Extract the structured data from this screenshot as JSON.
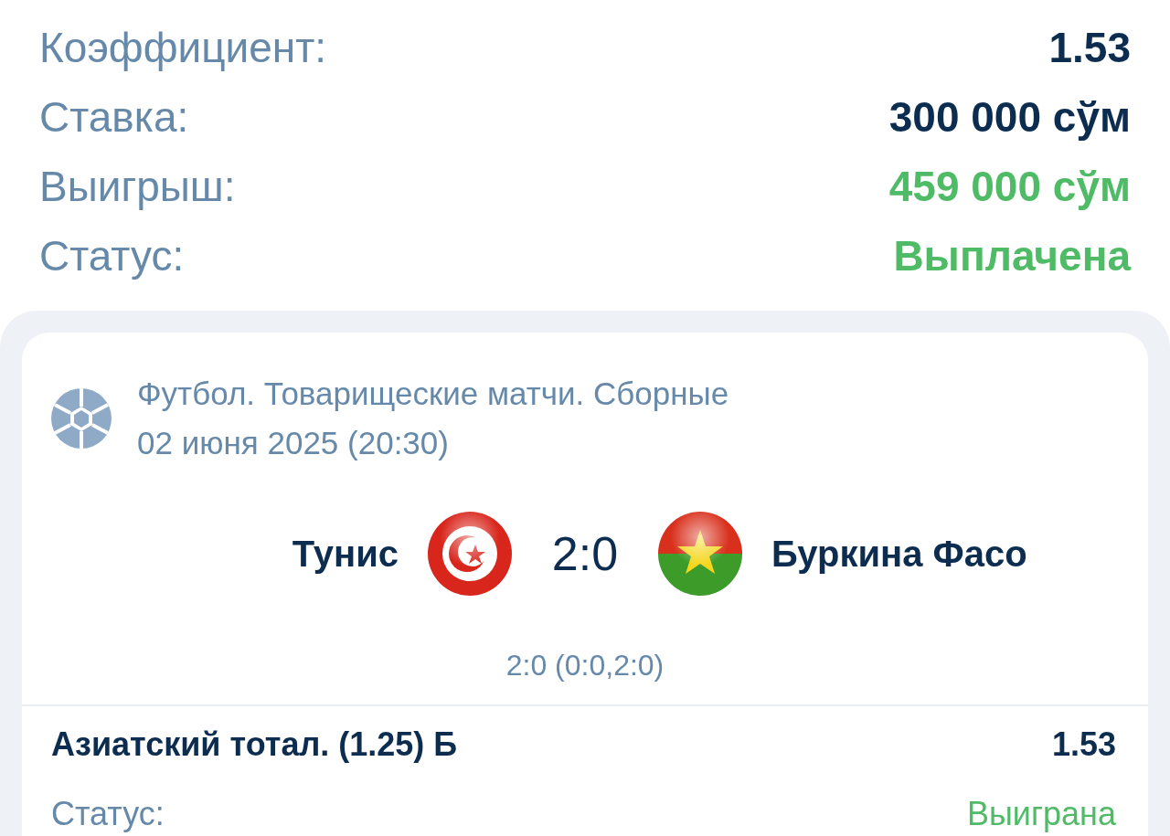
{
  "summary": [
    {
      "label": "Коэффициент:",
      "value": "1.53",
      "kind": "normal"
    },
    {
      "label": "Ставка:",
      "value": "300 000 сўм",
      "kind": "normal"
    },
    {
      "label": "Выигрыш:",
      "value": "459 000 сўм",
      "kind": "success"
    },
    {
      "label": "Статус:",
      "value": "Выплачена",
      "kind": "success"
    }
  ],
  "event": {
    "tournament": "Футбол. Товарищеские матчи. Сборные",
    "date": "02 июня 2025 (20:30)",
    "home": "Тунис",
    "score": "2:0",
    "away": "Буркина Фасо",
    "score_detail": "2:0 (0:0,2:0)"
  },
  "bet": {
    "market": "Азиатский тотал. (1.25) Б",
    "odds": "1.53",
    "status": {
      "label": "Статус:",
      "value": "Выиграна",
      "kind": "success"
    }
  }
}
